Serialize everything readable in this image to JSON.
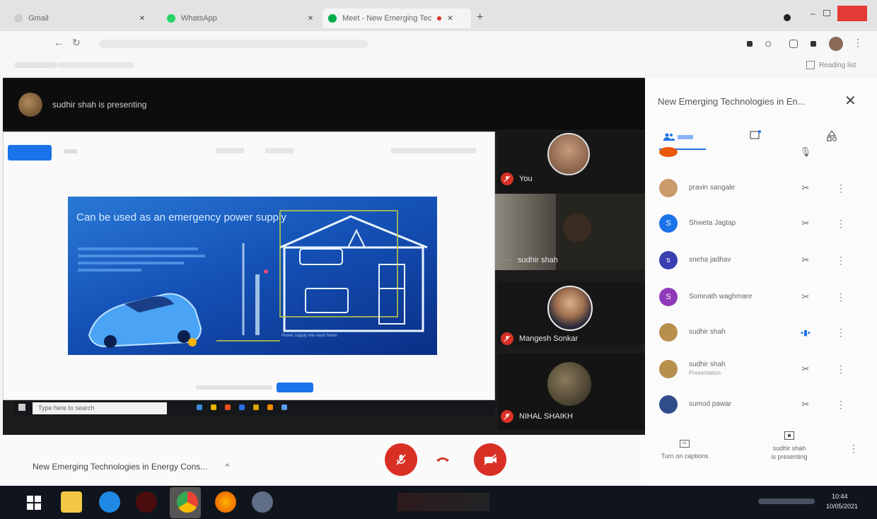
{
  "browser": {
    "tabs": [
      {
        "label": "Gmail"
      },
      {
        "label": "WhatsApp"
      },
      {
        "label": "Meet - New Emerging Tec"
      }
    ],
    "new_tab": "+",
    "bookmarks_right": "Reading list"
  },
  "meet": {
    "presenting_banner": "sudhir shah is presenting",
    "meeting_title": "New Emerging Technologies in Energy Cons...",
    "slide": {
      "title": "Can be used as an emergency power supply",
      "caption": "Power supply into each home"
    },
    "taskbar_search_placeholder": "Type here to search",
    "tiles": [
      {
        "name": "You"
      },
      {
        "name": "sudhir shah"
      },
      {
        "name": "Mangesh Sonkar"
      },
      {
        "name": "NIHAL SHAIKH"
      }
    ]
  },
  "panel": {
    "title": "New Emerging Technologies in En...",
    "participants": [
      {
        "name": "pravin sangale",
        "sub": "",
        "mic": "muted",
        "avatar_color": "#c99a6a",
        "initial": ""
      },
      {
        "name": "Shweta Jagtap",
        "sub": "",
        "mic": "muted",
        "avatar_color": "#1a73e8",
        "initial": "S"
      },
      {
        "name": "sneha jadhav",
        "sub": "",
        "mic": "muted",
        "avatar_color": "#3b3fb0",
        "initial": "s"
      },
      {
        "name": "Somnath waghmare",
        "sub": "",
        "mic": "muted",
        "avatar_color": "#8e3ab8",
        "initial": "S"
      },
      {
        "name": "sudhir shah",
        "sub": "",
        "mic": "speaking",
        "avatar_color": "#b8904d",
        "initial": ""
      },
      {
        "name": "sudhir shah",
        "sub": "Presentation",
        "mic": "muted",
        "avatar_color": "#b8904d",
        "initial": ""
      },
      {
        "name": "sumod pawar",
        "sub": "",
        "mic": "muted",
        "avatar_color": "#2f4d8a",
        "initial": ""
      }
    ],
    "captions_label": "Turn on captions",
    "presenting_label_1": "sudhir shah",
    "presenting_label_2": "is presenting"
  },
  "taskbar": {
    "time": "10:44",
    "date": "10/05/2021"
  },
  "colors": {
    "accent_blue": "#1a73e8",
    "danger_red": "#d93025"
  }
}
